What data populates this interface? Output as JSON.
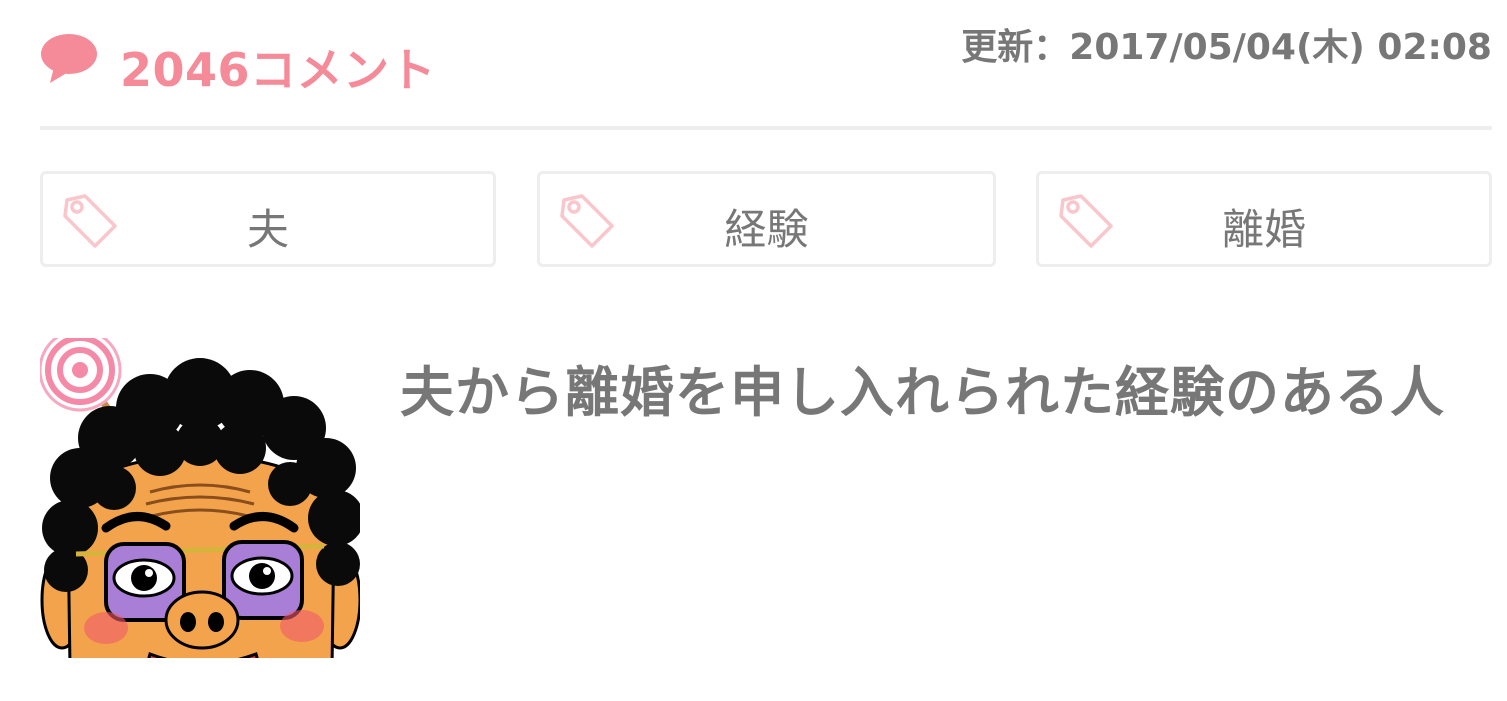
{
  "header": {
    "comment_count_label": "2046コメント",
    "updated_label": "更新：2017/05/04(木) 02:08",
    "comment_icon": "speech-bubble-icon"
  },
  "tags": [
    {
      "label": "夫",
      "icon": "tag-icon"
    },
    {
      "label": "経験",
      "icon": "tag-icon"
    },
    {
      "label": "離婚",
      "icon": "tag-icon"
    }
  ],
  "post": {
    "title": "夫から離婚を申し入れられた経験のある人",
    "avatar": "cartoon-avatar"
  },
  "colors": {
    "accent": "#f58a98",
    "text_gray": "#777777",
    "border": "#eeeeee",
    "tag_icon": "#f9c6cc"
  }
}
